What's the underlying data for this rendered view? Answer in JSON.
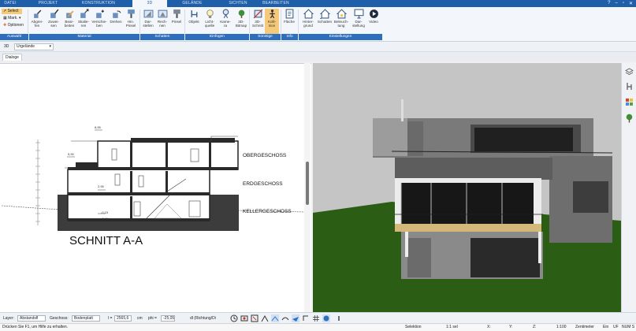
{
  "tabs": [
    "DATEI",
    "PROJEKT",
    "KONSTRUKTION",
    "3D",
    "GELÄNDE",
    "SICHTEN",
    "BEARBEITEN"
  ],
  "active_tab": "3D",
  "ribbon": {
    "select": {
      "select_label": "Select",
      "mark_label": "Mark.",
      "options_label": "Optionen"
    },
    "material_buttons": [
      "Abgrei-\nfen",
      "Zuwei-\nsen",
      "Bear-\nbeiten",
      "Skalie-\nren",
      "Verschie-\nben",
      "Drehen",
      "Hin.\nPinsel"
    ],
    "schatten_buttons": [
      "Dar-\nstellen",
      "Rech-\nnen",
      "Pinsel"
    ],
    "einfuegen_buttons": [
      "Objekt",
      "Licht-\nquelle",
      "Kame-\nra",
      "3D-\nBitmap"
    ],
    "sonstige_buttons": [
      "3D-\nSchnitt",
      "Kolli-\nsion"
    ],
    "info_buttons": [
      "Fläche"
    ],
    "einstellungen_buttons": [
      "Hinter-\ngrund",
      "Schatten",
      "Beleuch-\ntung",
      "Dar-\nstellung",
      "Video"
    ],
    "groups": [
      "Auswahl",
      "Material",
      "Schatten",
      "Einfügen",
      "Sonstige",
      "Info",
      "Einstellungen"
    ]
  },
  "view": {
    "mode_label": "3D",
    "dropdown_value": "Urgelände"
  },
  "dialog_tab": "Dialoge",
  "section": {
    "floors": [
      "OBERGESCHOSS",
      "ERDGESCHOSS",
      "KELLERGESCHOSS"
    ],
    "title": "SCHNITT A-A",
    "levels": [
      "8,95",
      "5,90",
      "2,95",
      "0,00",
      "-0,15",
      "-2,95"
    ]
  },
  "toolstrip": {
    "layer_label": "Layer:",
    "layer_value": "Abstandsfl",
    "geschoss_label": "Geschoss:",
    "geschoss_value": "Bodenplatt",
    "l_label": "l =",
    "l_value": "2565,6",
    "l_unit": "cm",
    "phi_label": "phi =",
    "phi_value": "-25,05",
    "dl_label": "dl (Richtung/Di"
  },
  "status": {
    "hint": "Drücken Sie F1, um Hilfe zu erhalten.",
    "mode": "Selektion",
    "sel": "1:1 sel",
    "x_label": "X:",
    "y_label": "Y:",
    "z_label": "Z:",
    "scale": "1:100",
    "unit": "Zentimeter",
    "ein": "Ein",
    "uf": "UF",
    "num": "NUM S"
  },
  "colors": {
    "tab_bar": "#1f5ea8",
    "group_label": "#2d6fbd",
    "active_button": "#f5c97a",
    "lawn": "#2c5d14",
    "sky": "#c5c5c5"
  }
}
